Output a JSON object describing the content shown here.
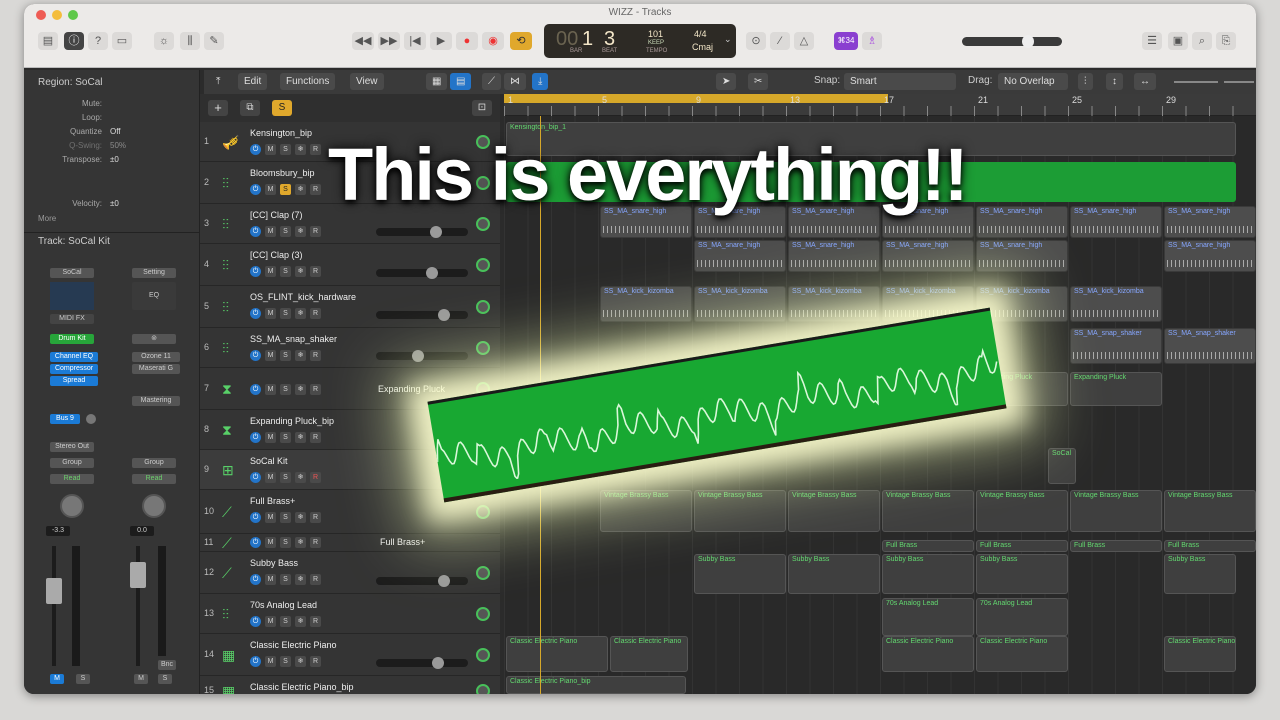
{
  "window": {
    "title": "WIZZ - Tracks"
  },
  "transport": {
    "bar": "1",
    "beat": "3",
    "bar_lbl": "BAR",
    "beat_lbl": "BEAT",
    "tempo": "101",
    "tempo_keep": "KEEP",
    "tempo_lbl": "TEMPO",
    "sig": "4/4",
    "key": "Cmaj",
    "counter_prefix": "00",
    "badge": "⌘34"
  },
  "toolbar": {
    "edit": "Edit",
    "functions": "Functions",
    "view": "View",
    "snap_label": "Snap:",
    "snap_value": "Smart",
    "drag_label": "Drag:",
    "drag_value": "No Overlap"
  },
  "inspector": {
    "region_header": "Region: SoCal",
    "rows": [
      {
        "k": "Mute:",
        "v": ""
      },
      {
        "k": "Loop:",
        "v": ""
      },
      {
        "k": "Quantize",
        "v": "Off"
      },
      {
        "k": "Q-Swing:",
        "v": "50%"
      },
      {
        "k": "Transpose:",
        "v": "±0"
      },
      {
        "k": "Velocity:",
        "v": "±0"
      }
    ],
    "more": "More",
    "track_header": "Track: SoCal Kit",
    "strip1": {
      "setting": "SoCal",
      "midi_fx": "MIDI FX",
      "inst": "Drum Kit",
      "fx": [
        "Channel EQ",
        "Compressor",
        "Spread"
      ],
      "send": "Bus 9",
      "out": "Stereo Out",
      "group": "Group",
      "auto": "Read",
      "vol": "-3.3",
      "m": "M",
      "s": "S"
    },
    "strip2": {
      "setting": "Setting",
      "eq": "EQ",
      "fx": [
        "Ozone 11",
        "Maserati G"
      ],
      "mastering": "Mastering",
      "group": "Group",
      "auto": "Read",
      "vol": "0.0",
      "bnc": "Bnc",
      "m": "M",
      "s": "S"
    }
  },
  "tracks": [
    {
      "num": "1",
      "name": "Kensington_bip"
    },
    {
      "num": "2",
      "name": "Bloomsbury_bip"
    },
    {
      "num": "3",
      "name": "[CC] Clap (7)"
    },
    {
      "num": "4",
      "name": "[CC] Clap (3)"
    },
    {
      "num": "5",
      "name": "OS_FLINT_kick_hardware"
    },
    {
      "num": "6",
      "name": "SS_MA_snap_shaker"
    },
    {
      "num": "7",
      "name": "Expanding Pluck"
    },
    {
      "num": "8",
      "name": "Expanding Pluck_bip"
    },
    {
      "num": "9",
      "name": "SoCal Kit"
    },
    {
      "num": "10",
      "name": "Full Brass+"
    },
    {
      "num": "11",
      "name": "Full Brass+"
    },
    {
      "num": "12",
      "name": "Subby Bass"
    },
    {
      "num": "13",
      "name": "70s Analog Lead"
    },
    {
      "num": "14",
      "name": "Classic Electric Piano"
    },
    {
      "num": "15",
      "name": "Classic Electric Piano_bip"
    }
  ],
  "ruler": {
    "bars": [
      "1",
      "5",
      "9",
      "13",
      "17",
      "21",
      "25",
      "29"
    ]
  },
  "regions": {
    "kens": "Kensington_bip_1",
    "snare": "SS_MA_snare_high",
    "kick": "SS_MA_kick_kizomba",
    "snap": "SS_MA_snap_shaker",
    "pluck": "Expanding Pluck",
    "socal": "SoCal",
    "vbass": "Vintage Brassy Bass",
    "fbrass": "Full Brass",
    "subby": "Subby Bass",
    "lead": "70s Analog Lead",
    "piano": "Classic Electric Piano",
    "pianobip": "Classic Electric Piano_bip"
  },
  "overlay": {
    "caption": "This is everything!!"
  }
}
